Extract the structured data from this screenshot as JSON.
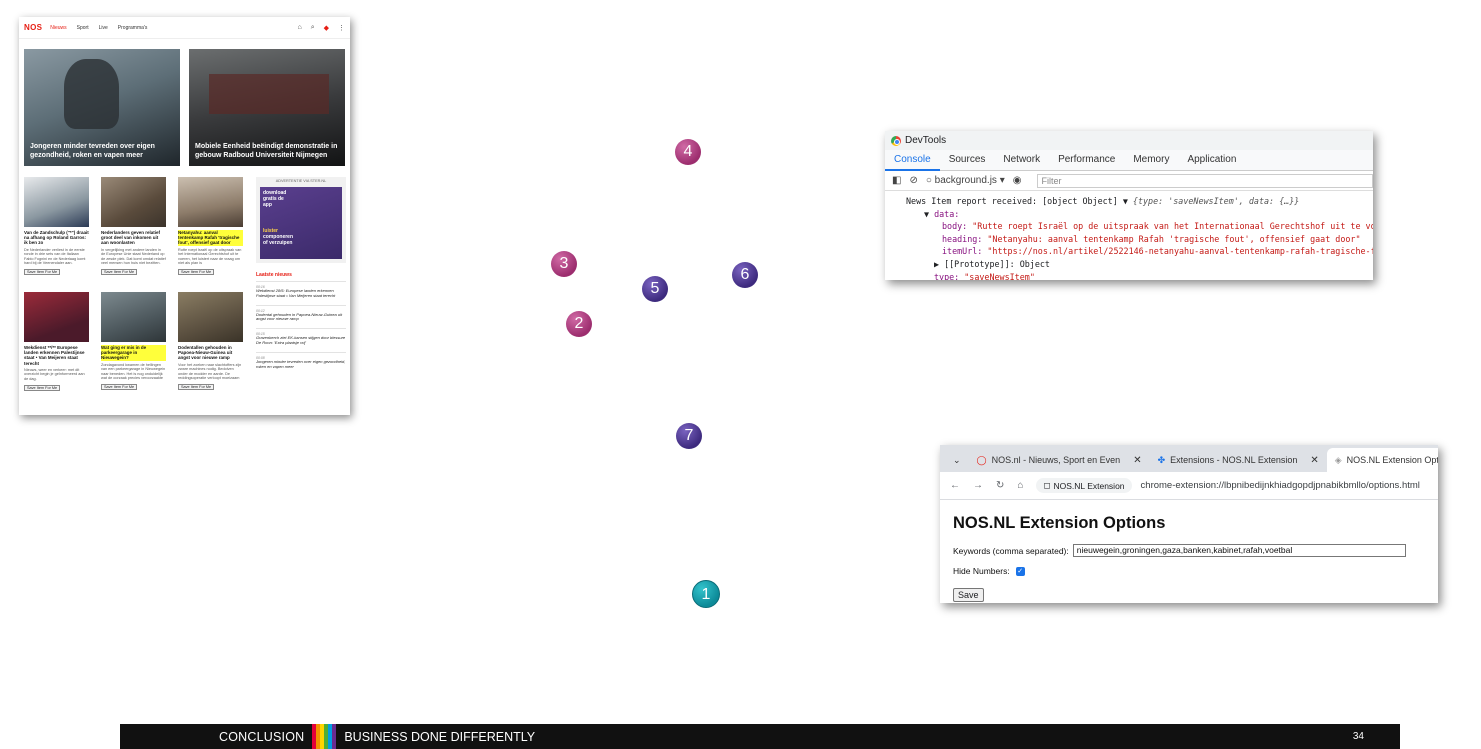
{
  "nos": {
    "logo": "NOS",
    "nav": [
      "Nieuws",
      "Sport",
      "Live",
      "Programma's"
    ],
    "hero1_caption": "Jongeren minder tevreden over eigen gezondheid, roken en vapen meer",
    "hero2_caption": "Mobiele Eenheid beëindigt demonstratie in gebouw Radboud Universiteit Nijmegen",
    "cards": [
      {
        "title": "Van de Zandschulp (\"*\") draait na afhang op Roland Garros: ik ben zo",
        "desc": "De Nederlander verliest in de eerste ronde in drie sets van de Italiaan Fabio Fognini en de Nederlaag komt hard bij de Veenendaler aan.",
        "button": "Save Item For Me"
      },
      {
        "title": "Nederlanders geven relatief groot deel van inkomen uit aan woonlasten",
        "desc": "In vergelijking met andere landen in de Europese Unie staat Nederland op de zesde plek. Dat komt omdat relatief veel mensen hun huis niet bezitten.",
        "button": "Save Item For Me"
      },
      {
        "title": "Netanyahu: aanval tentenkamp Rafah 'tragische fout', offensief gaat door",
        "desc": "Rutte roept Israël op de uitspraak van het Internationaal Gerechtshof uit te voeren, het luistert naar de vraag om niet als plan is",
        "button": "Save Item For Me"
      },
      {
        "title": "Wekdienst **/** Europese landen erkennen Palestijnse staat • Van Meijeren staat terecht",
        "desc": "Nieuws, weer en verkeer: met dit overzicht begin je geïnformeerd aan de dag.",
        "button": "Save Item For Me"
      },
      {
        "title": "Wat ging er mis in de parkeergarage in Nieuwegein?",
        "desc": "Zondagavond kwamen de hellingen van een parkeergarage in Nieuwegein naar beneden. Het is nog onduidelijk wat de oorzaak precies veroorzaakte",
        "button": "Save Item For Me"
      },
      {
        "title": "Dodentallen gehouden in Papoea-Nieuw-Guinea uit angst voor nieuwe ramp",
        "desc": "Voor het zoeken naar slachtoffers zijn zware machines nodig. Bedolven onder de modder en aarde. De reddingsoperatie verloopt moeizaam",
        "button": "Save Item For Me"
      }
    ],
    "ad": {
      "label": "ADVERTENTIE VIA STER.NL",
      "line1": "download",
      "line2": "gratis de",
      "line3": "app",
      "line4": "luister",
      "line5": "componeren",
      "line6": "of verzuipen"
    },
    "latest": {
      "heading": "Laatste nieuws",
      "items": [
        {
          "time": "00:16",
          "text": "Wekdienst 28/5: Europese landen erkennen Palestijnse staat • Van Meijeren staat terecht"
        },
        {
          "time": "00:12",
          "text": "Dodental gehouden in Papoea-Nieuw-Guinea uit angst voor nieuwe ramp"
        },
        {
          "time": "00:15",
          "text": "Gravenberch ziet EK-kansen stijgen door blessure De Roon: 'Extra plaatsje vrij'"
        },
        {
          "time": "00:08",
          "text": "Jongeren minder tevreden over eigen gezondheid, roken en vapen meer"
        }
      ]
    }
  },
  "markers": [
    "1",
    "2",
    "3",
    "4",
    "5",
    "6",
    "7"
  ],
  "devtools": {
    "title": "DevTools",
    "tabs": [
      "Console",
      "Sources",
      "Network",
      "Performance",
      "Memory",
      "Application"
    ],
    "context": "background.js",
    "filter_placeholder": "Filter",
    "log": {
      "line1_prefix": "News Item report received: [object Object] ",
      "line1_summary": "{type: 'saveNewsItem', data: {…}}",
      "data_label": "data:",
      "body_key": "body:",
      "body_val": "\"Rutte roept Israël op de uitspraak van het Internationaal Gerechtshof uit te vo",
      "heading_key": "heading:",
      "heading_val": "\"Netanyahu: aanval tentenkamp Rafah 'tragische fout', offensief gaat door\"",
      "url_key": "itemUrl:",
      "url_val": "\"https://nos.nl/artikel/2522146-netanyahu-aanval-tentenkamp-rafah-tragische-f",
      "proto": "[[Prototype]]: Object",
      "type_key": "type:",
      "type_val": "\"saveNewsItem\""
    }
  },
  "options": {
    "tabs": [
      "NOS.nl - Nieuws, Sport en Even",
      "Extensions - NOS.NL Extension",
      "NOS.NL Extension Options"
    ],
    "chip": "NOS.NL Extension",
    "url": "chrome-extension://lbpnibedijnkhiadgopdjpnabikbmllo/options.html",
    "heading": "NOS.NL Extension Options",
    "keywords_label": "Keywords (comma separated):",
    "keywords_value": "nieuwegein,groningen,gaza,banken,kabinet,rafah,voetbal",
    "hide_label": "Hide Numbers:",
    "save": "Save"
  },
  "footer": {
    "left": "CONCLUSION",
    "right": "BUSINESS DONE DIFFERENTLY",
    "page": "34",
    "stripe_colors": [
      "#e4003a",
      "#f39200",
      "#ffd500",
      "#52ae32",
      "#009fe3",
      "#6a2c91"
    ]
  }
}
